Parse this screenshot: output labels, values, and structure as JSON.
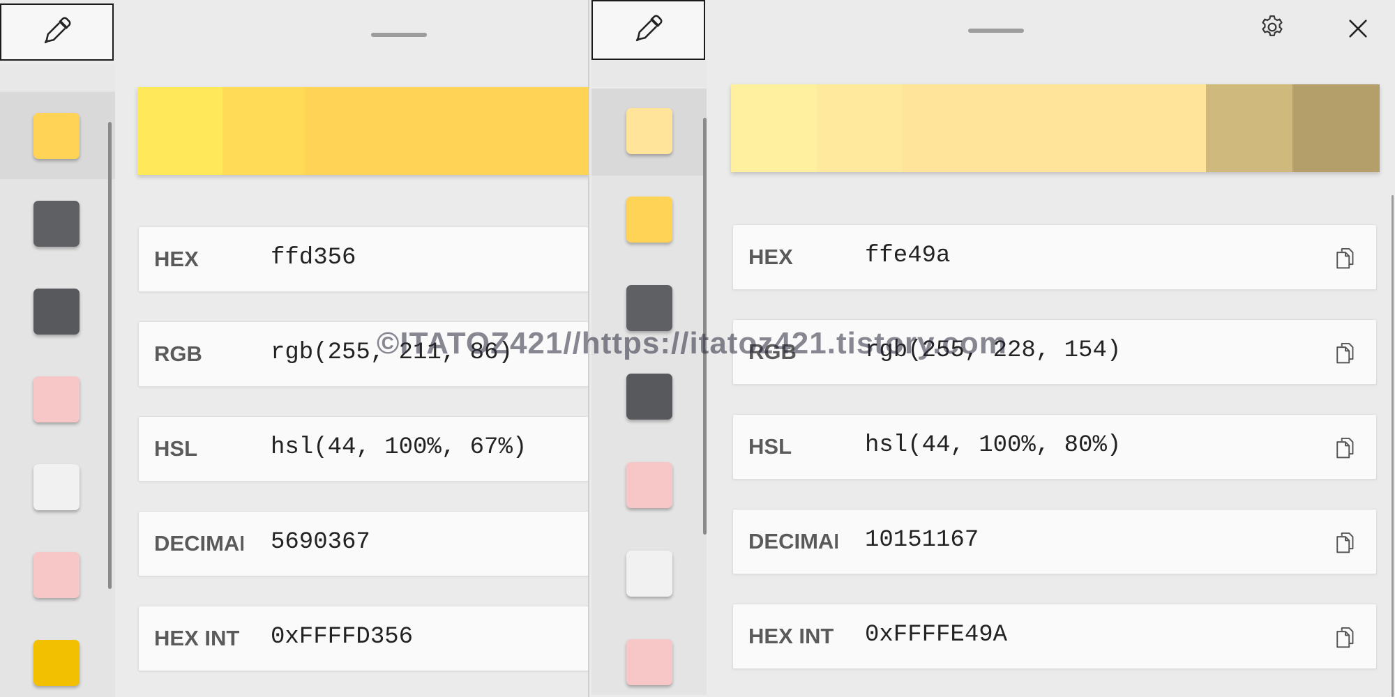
{
  "colors": {
    "window_bg": "#ebebeb",
    "sidebar_bg": "#e4e4e4",
    "row_bg": "#fafafa",
    "label_text": "#5a5a5a",
    "value_text": "#222222"
  },
  "left": {
    "picker_icon": "eyedropper-icon",
    "swatches": [
      "#ffd356",
      "#5f6063",
      "#58595c",
      "#f7c6c6",
      "#f1f1f1",
      "#f7c6c6",
      "#f2c000"
    ],
    "shades": [
      "#ffe85a",
      "#ffdb58",
      "#ffd356",
      "#ffd356"
    ],
    "formats": [
      {
        "label": "HEX",
        "value": "ffd356"
      },
      {
        "label": "RGB",
        "value": "rgb(255, 211, 86)"
      },
      {
        "label": "HSL",
        "value": "hsl(44, 100%, 67%)"
      },
      {
        "label": "DECIMAL",
        "value": "5690367"
      },
      {
        "label": "HEX INT",
        "value": "0xFFFFD356"
      }
    ]
  },
  "right": {
    "picker_icon": "eyedropper-icon",
    "settings_icon": "gear-icon",
    "close_icon": "close-icon",
    "swatches": [
      "#ffe49a",
      "#ffd356",
      "#5f6063",
      "#58595c",
      "#f7c6c6",
      "#f1f1f1",
      "#f7c6c6"
    ],
    "shades": [
      "#fff0a0",
      "#ffe99c",
      "#ffe49a",
      "#ffe49a",
      "#d0b97c",
      "#b49e6a"
    ],
    "formats": [
      {
        "label": "HEX",
        "value": "ffe49a"
      },
      {
        "label": "RGB",
        "value": "rgb(255, 228, 154)"
      },
      {
        "label": "HSL",
        "value": "hsl(44, 100%, 80%)"
      },
      {
        "label": "DECIMAL",
        "value": "10151167"
      },
      {
        "label": "HEX INT",
        "value": "0xFFFFE49A"
      }
    ],
    "copy_icon": "copy-icon"
  },
  "watermark": "©ITATOZ421//https://itatoz421.tistory.com"
}
